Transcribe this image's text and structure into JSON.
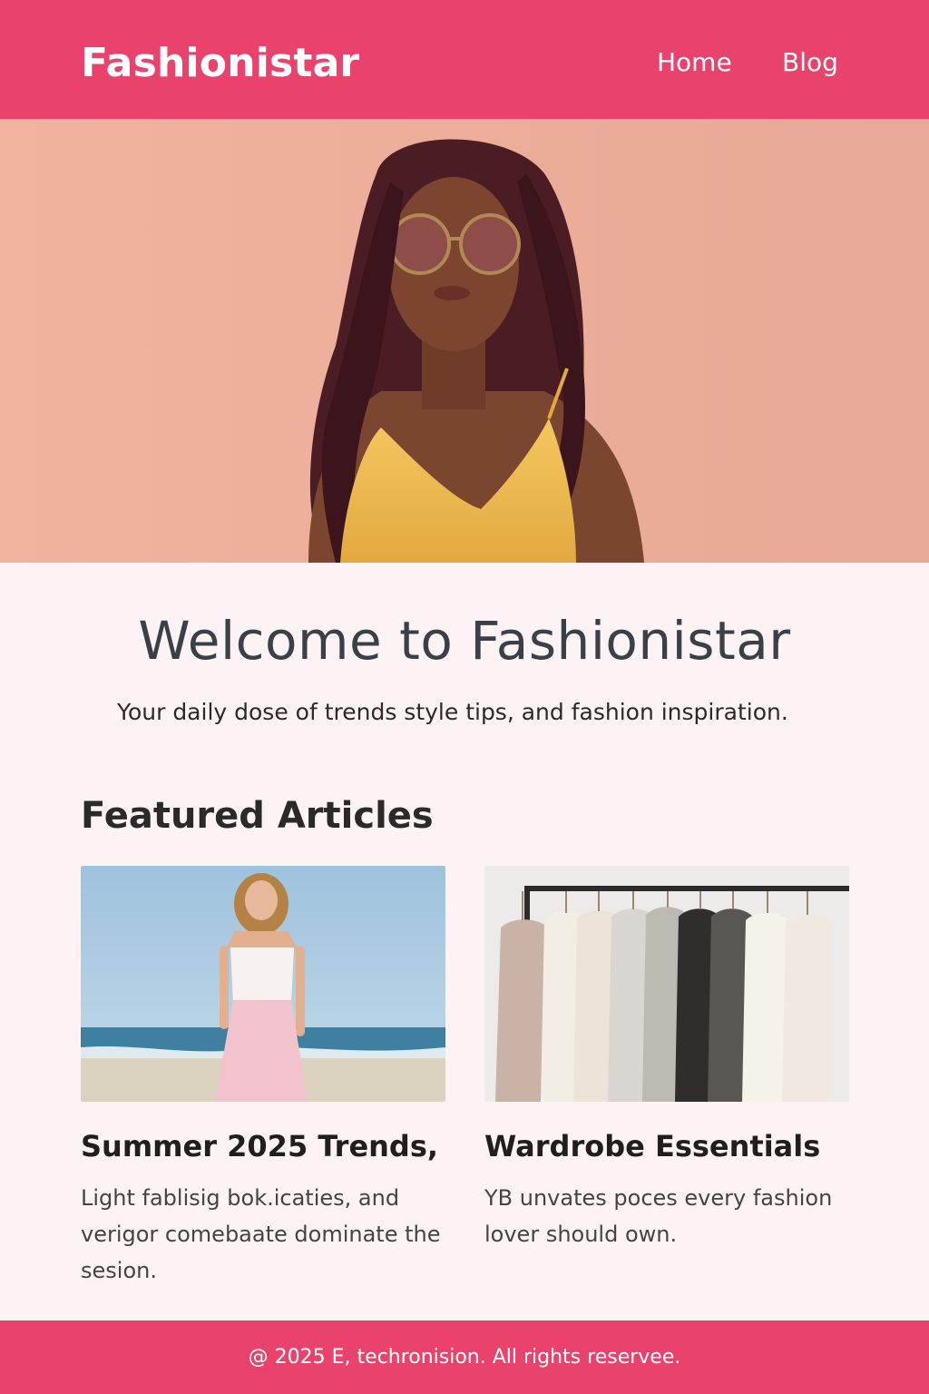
{
  "header": {
    "logo": "Fashionistar",
    "nav": [
      {
        "label": "Home"
      },
      {
        "label": "Blog"
      }
    ]
  },
  "hero": {
    "image": "hero-model-photo"
  },
  "welcome": {
    "title": "Welcome to Fashionistar",
    "subtitle": "Your daily dose of trends style tips, and fashion inspiration."
  },
  "featured": {
    "title": "Featured Articles",
    "articles": [
      {
        "title": "Summer 2025 Trends,",
        "excerpt": "Light fablisig bok.icaties, and verigor comebaate dominate the sesion.",
        "image": "beach-dress-photo"
      },
      {
        "title": "Wardrobe Essentials",
        "excerpt": "YB unvates poces every fashion lover should own.",
        "image": "clothing-rack-photo"
      }
    ]
  },
  "footer": {
    "text": "@ 2025 E, techronision. All rights reservee."
  },
  "colors": {
    "brand": "#e8426d",
    "background": "#fdf3f4",
    "heading": "#3a4048"
  }
}
